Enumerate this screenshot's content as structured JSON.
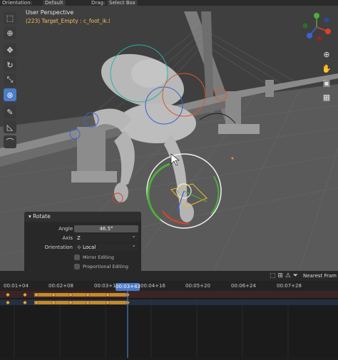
{
  "header": {
    "orientation_label": "Orientation:",
    "orientation_value": "Default",
    "drag_label": "Drag:",
    "drag_value": "Select Box"
  },
  "viewport": {
    "title": "User Perspective",
    "subtitle": "(223) Target_Empty : c_foot_ik.l"
  },
  "operator_panel": {
    "title": "Rotate",
    "angle_label": "Angle",
    "angle_value": "46.5°",
    "axis_label": "Axis",
    "axis_value": "Z",
    "orientation_label": "Orientation",
    "orientation_value": "Local",
    "mirror_label": "Mirror Editing",
    "proportional_label": "Proportional Editing"
  },
  "timeline": {
    "snap_label": "Nearest Fram",
    "ticks": [
      "00:01+04",
      "00:02+08",
      "00:03+1",
      "00:04+16",
      "00:05+20",
      "00:06+24",
      "00:07+28"
    ],
    "current_frame": "00:03+43"
  },
  "colors": {
    "accent": "#4a7cc9",
    "keyframe": "#e8a33a",
    "gizmo_green": "#4caf3a",
    "gizmo_red": "#e0402a",
    "text_yellow": "#f0c060"
  },
  "icons": {
    "toolbar": [
      "select-box-icon",
      "cursor-icon",
      "move-icon",
      "rotate-icon",
      "scale-icon",
      "transform-icon",
      "annotate-icon",
      "measure-icon",
      "bone-roll-icon"
    ],
    "nav": [
      "zoom-icon",
      "hand-pan-icon",
      "camera-icon",
      "grid-icon"
    ]
  }
}
